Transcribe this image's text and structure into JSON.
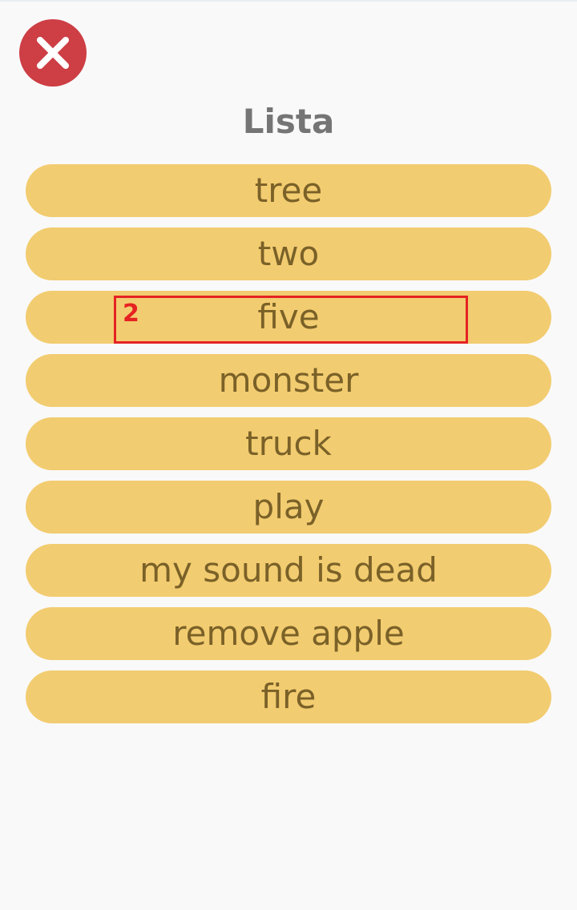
{
  "header": {
    "title": "Lista",
    "close_icon": "close-icon",
    "close_color": "#cd3e45"
  },
  "list": {
    "item_color": "#f2cc70",
    "text_color": "#7a6128",
    "items": [
      {
        "label": "tree"
      },
      {
        "label": "two"
      },
      {
        "label": "five"
      },
      {
        "label": "monster"
      },
      {
        "label": "truck"
      },
      {
        "label": "play"
      },
      {
        "label": "my sound is dead"
      },
      {
        "label": "remove apple"
      },
      {
        "label": "fire"
      }
    ]
  },
  "annotation": {
    "label": "2",
    "color": "#e52222"
  }
}
